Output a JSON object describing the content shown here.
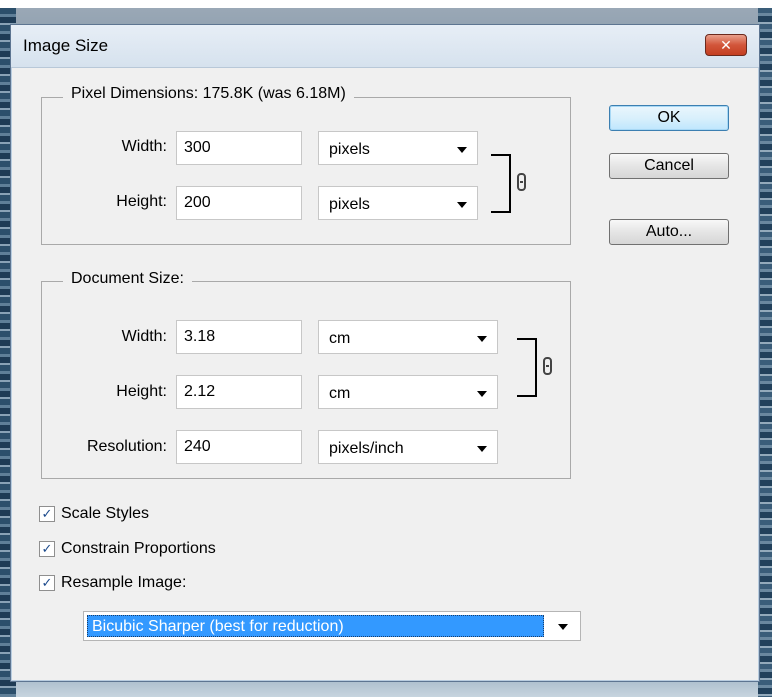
{
  "dialog": {
    "title": "Image Size",
    "close_glyph": "✕"
  },
  "pixel_dimensions": {
    "legend": "Pixel Dimensions:  175.8K (was 6.18M)",
    "width_label": "Width:",
    "width_value": "300",
    "width_unit": "pixels",
    "height_label": "Height:",
    "height_value": "200",
    "height_unit": "pixels"
  },
  "document_size": {
    "legend": "Document Size:",
    "width_label": "Width:",
    "width_value": "3.18",
    "width_unit": "cm",
    "height_label": "Height:",
    "height_value": "2.12",
    "height_unit": "cm",
    "resolution_label": "Resolution:",
    "resolution_value": "240",
    "resolution_unit": "pixels/inch"
  },
  "buttons": {
    "ok": "OK",
    "cancel": "Cancel",
    "auto": "Auto..."
  },
  "options": {
    "scale_styles": "Scale Styles",
    "constrain_proportions": "Constrain Proportions",
    "resample_image": "Resample Image:",
    "check_glyph": "✓"
  },
  "resample_method": {
    "selected": "Bicubic Sharper (best for reduction)"
  },
  "icons": {
    "chain": "chain-link-icon",
    "dropdown": "chevron-down-icon",
    "close": "close-icon"
  },
  "colors": {
    "selection": "#3399ff",
    "close_button": "#c43f21",
    "dialog_bg": "#f0f0f0"
  }
}
